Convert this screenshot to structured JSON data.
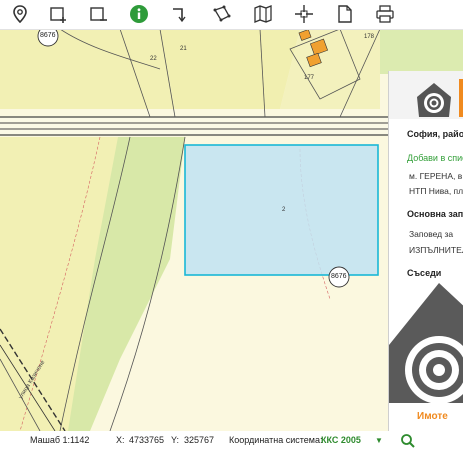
{
  "toolbar": {
    "items": [
      {
        "name": "location-pin-icon"
      },
      {
        "name": "add-rectangle-icon"
      },
      {
        "name": "remove-rectangle-icon"
      },
      {
        "name": "info-icon"
      },
      {
        "name": "turn-arrow-icon"
      },
      {
        "name": "polygon-icon"
      },
      {
        "name": "map-icon"
      },
      {
        "name": "crosshair-icon"
      },
      {
        "name": "document-icon"
      },
      {
        "name": "print-icon"
      }
    ]
  },
  "map": {
    "labels": {
      "top_parcel_id": "8676",
      "bottom_parcel_id": "8676",
      "parcel_22": "22",
      "parcel_21": "21",
      "parcel_178": "178",
      "parcel_177": "177",
      "parcel_2": "2",
      "road_label": "улица Казичене"
    }
  },
  "panel": {
    "title": "София, райо",
    "add_link": "Добави в спис",
    "line1": "м. ГЕРЕНА, в",
    "line2": "НТП Нива, пл",
    "section_main": "Основна зап",
    "line3": "Заповед   за",
    "line4": "ИЗПЪЛНИТЕЛ",
    "section_neighbors": "Съседи",
    "brand": "Имоте"
  },
  "statusbar": {
    "scale_label": "Машаб 1:",
    "scale_value": "1142",
    "x_label": "X:",
    "x_value": "4733765",
    "y_label": "Y:",
    "y_value": "325767",
    "crs_label": "Координатна система:",
    "crs_value": "ККС 2005",
    "crs_arrow": "▼"
  },
  "colors": {
    "map_yellow": "#f2f0b4",
    "map_green": "#dcebb0",
    "selection_fill": "#bfe3f3",
    "selection_stroke": "#19b8d6",
    "accent_green": "#2e8b2e",
    "brand_orange": "#f08a1f"
  }
}
